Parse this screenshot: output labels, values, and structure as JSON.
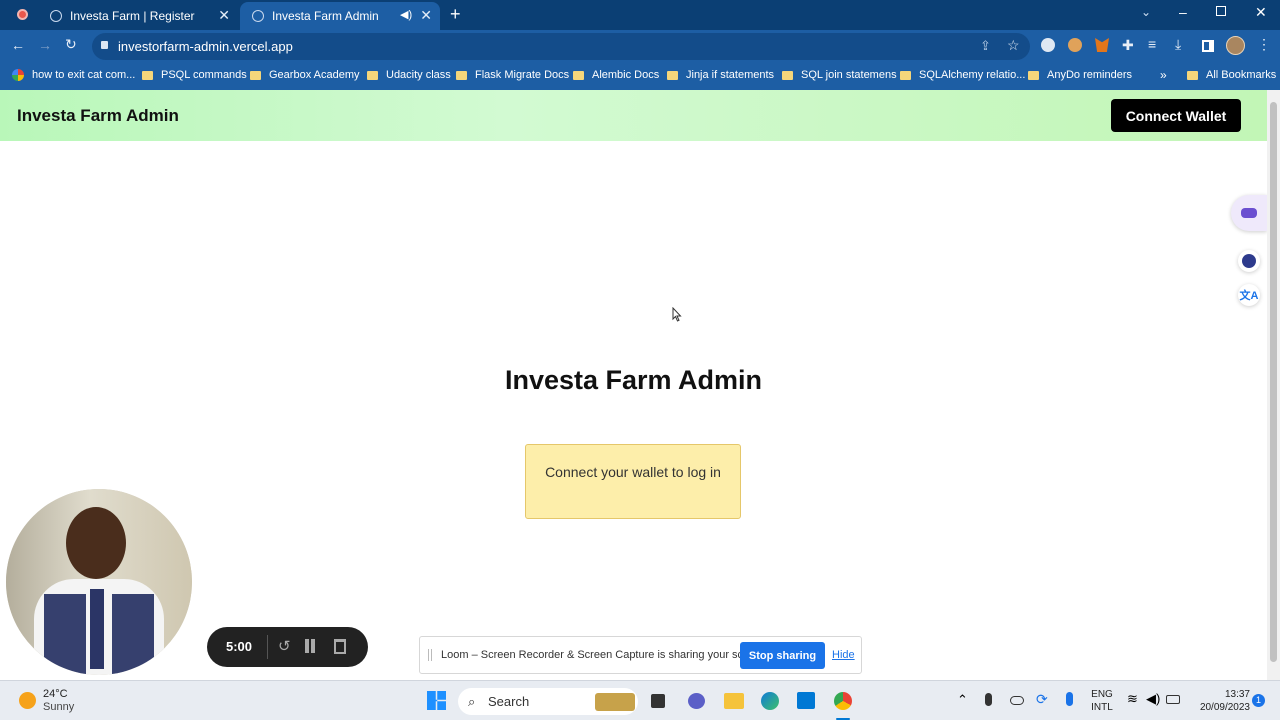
{
  "tabs": [
    {
      "title": "Investa Farm | Register"
    },
    {
      "title": "Investa Farm Admin"
    }
  ],
  "address": {
    "url": "investorfarm-admin.vercel.app"
  },
  "bookmarks": [
    "how to exit cat com...",
    "PSQL commands",
    "Gearbox Academy",
    "Udacity class",
    "Flask Migrate Docs",
    "Alembic Docs",
    "Jinja if statements",
    "SQL join statemens",
    "SQLAlchemy relatio...",
    "AnyDo reminders"
  ],
  "bookmarks_all": "All Bookmarks",
  "app": {
    "brand": "Investa Farm Admin",
    "connect_label": "Connect Wallet",
    "title": "Investa Farm Admin",
    "notice": "Connect your wallet to log in"
  },
  "loom": {
    "timer": "5:00",
    "share_text": "Loom – Screen Recorder & Screen Capture is sharing your screen.",
    "stop_label": "Stop sharing",
    "hide_label": "Hide"
  },
  "taskbar": {
    "weather_temp": "24°C",
    "weather_desc": "Sunny",
    "search_placeholder": "Search",
    "lang1": "ENG",
    "lang2": "INTL",
    "time": "13:37",
    "date": "20/09/2023",
    "notif_count": "1"
  },
  "colors": {
    "chrome_dark": "#0b3f74",
    "chrome": "#1d5ea4",
    "header_green": "#c2f6b6",
    "notice_bg": "#fdeeaa",
    "primary_blue": "#1a73e8"
  }
}
